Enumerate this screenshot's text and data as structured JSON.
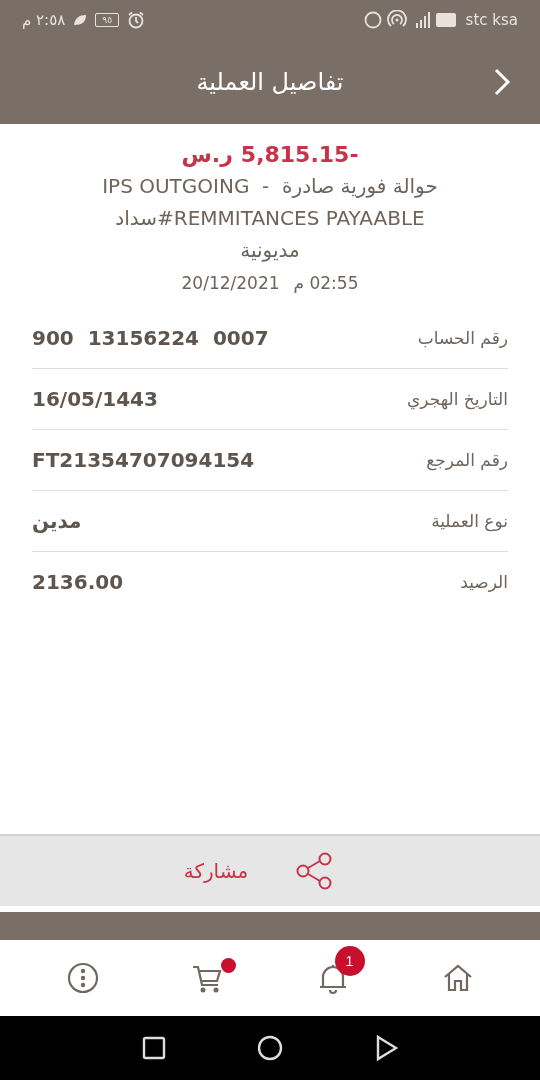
{
  "status_bar": {
    "time": "٢:٥٨ م",
    "battery": "٩٥",
    "carrier": "stc ksa"
  },
  "header": {
    "title": "تفاصيل العملية"
  },
  "summary": {
    "amount": "5,815.15-",
    "currency": "ر.س",
    "description_lines": [
      "حوالة فورية صادرة  -  IPS OUTGOING",
      "سداد#REMMITANCES PAYAABLE",
      "مديونية"
    ],
    "date": "20/12/2021",
    "time": "02:55 م"
  },
  "details": [
    {
      "label": "رقم الحساب",
      "value": "900  13156224  0007"
    },
    {
      "label": "التاريخ الهجري",
      "value": "16/05/1443"
    },
    {
      "label": "رقم المرجع",
      "value": "FT21354707094154"
    },
    {
      "label": "نوع العملية",
      "value": "مدين"
    },
    {
      "label": "الرصيد",
      "value": "2136.00"
    }
  ],
  "share": {
    "label": "مشاركة"
  },
  "bottom_nav": [
    {
      "kind": "more"
    },
    {
      "kind": "cart",
      "dot": true
    },
    {
      "kind": "notifications",
      "badge": "1"
    },
    {
      "kind": "home"
    }
  ]
}
